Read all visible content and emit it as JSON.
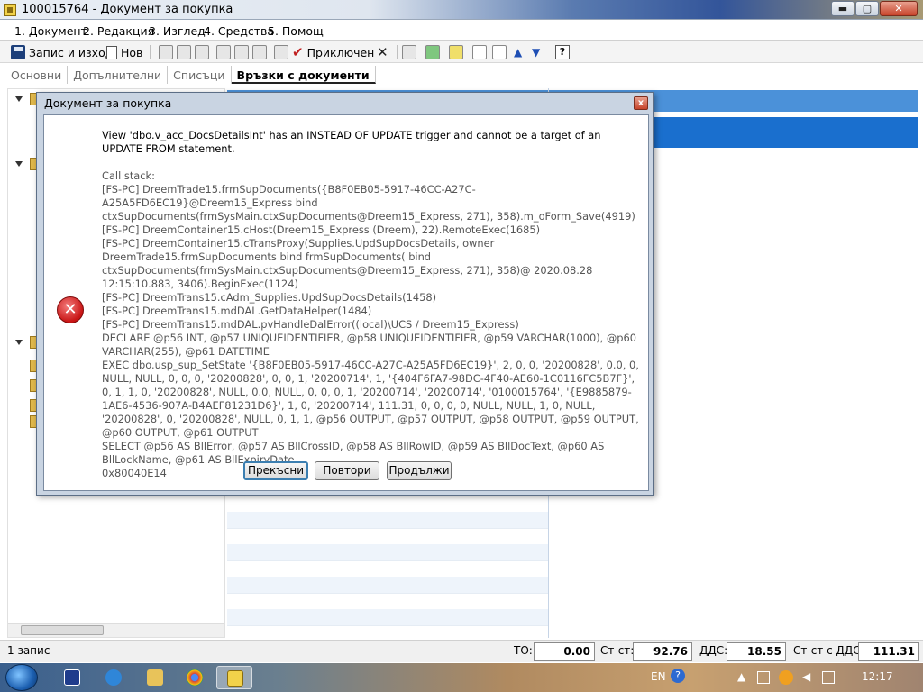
{
  "window": {
    "title": "100015764 - Документ за покупка",
    "buttons": {
      "minimize": "▬",
      "maximize": "▢",
      "close": "✕"
    }
  },
  "menu": [
    {
      "label": "1. Документ"
    },
    {
      "label": "2. Редакция"
    },
    {
      "label": "3. Изглед"
    },
    {
      "label": "4. Средства"
    },
    {
      "label": "5. Помощ"
    }
  ],
  "toolbar": {
    "save_exit_label": "Запис и изход",
    "new_label": "Нов",
    "attached_label": "Приключен",
    "help_label": "?"
  },
  "tabs": [
    {
      "label": "Основни"
    },
    {
      "label": "Допълнителни"
    },
    {
      "label": "Списъци"
    },
    {
      "label": "Връзки с документи",
      "active": true
    }
  ],
  "dialog": {
    "title": "Документ за покупка",
    "close_label": "x",
    "icon": "error-icon",
    "message": "View 'dbo.v_acc_DocsDetailsInt' has an INSTEAD OF UPDATE trigger and cannot be a target of an UPDATE FROM statement.",
    "stack_lines": [
      "Call stack:",
      "[FS-PC] DreemTrade15.frmSupDocuments({B8F0EB05-5917-46CC-A27C-A25A5FD6EC19}@Dreem15_Express bind ctxSupDocuments(frmSysMain.ctxSupDocuments@Dreem15_Express, 271), 358).m_oForm_Save(4919)",
      "[FS-PC] DreemContainer15.cHost(Dreem15_Express (Dreem), 22).RemoteExec(1685)",
      "[FS-PC] DreemContainer15.cTransProxy(Supplies.UpdSupDocsDetails, owner DreemTrade15.frmSupDocuments bind frmSupDocuments( bind ctxSupDocuments(frmSysMain.ctxSupDocuments@Dreem15_Express, 271), 358)@ 2020.08.28 12:15:10.883, 3406).BeginExec(1124)",
      "[FS-PC] DreemTrans15.cAdm_Supplies.UpdSupDocsDetails(1458)",
      "[FS-PC] DreemTrans15.mdDAL.GetDataHelper(1484)",
      "[FS-PC] DreemTrans15.mdDAL.pvHandleDalError((local)\\UCS / Dreem15_Express)",
      "DECLARE @p56 INT, @p57 UNIQUEIDENTIFIER, @p58 UNIQUEIDENTIFIER, @p59 VARCHAR(1000), @p60 VARCHAR(255), @p61 DATETIME",
      "EXEC dbo.usp_sup_SetState '{B8F0EB05-5917-46CC-A27C-A25A5FD6EC19}', 2, 0, 0, '20200828', 0.0, 0, NULL, NULL, 0, 0, 0, '20200828', 0, 0, 1, '20200714', 1, '{404F6FA7-98DC-4F40-AE60-1C0116FC5B7F}', 0, 1, 1, 0, '20200828', NULL, 0.0, NULL, 0, 0, 0, 1, '20200714', '20200714', '0100015764', '{E9885879-1AE6-4536-907A-B4AEF81231D6}', 1, 0, '20200714', 111.31, 0, 0, 0, 0, NULL, NULL, 1, 0, NULL, '20200828', 0, '20200828', NULL, 0, 1, 1, @p56 OUTPUT, @p57 OUTPUT, @p58 OUTPUT, @p59 OUTPUT, @p60 OUTPUT, @p61 OUTPUT",
      "SELECT @p56 AS BllError, @p57 AS BllCrossID, @p58 AS BllRowID, @p59 AS BllDocText, @p60 AS BllLockName, @p61 AS BllExpiryDate",
      "0x80040E14"
    ],
    "buttons": {
      "abort": "Прекъсни",
      "retry": "Повтори",
      "continue": "Продължи"
    }
  },
  "status": {
    "record_count": "1 запис",
    "to_label": "ТО:",
    "to_value": "0.00",
    "cost_label": "Ст-ст:",
    "cost_value": "92.76",
    "vat_label": "ДДС:",
    "vat_value": "18.55",
    "cost_vat_label": "Ст-ст с ДДС:",
    "cost_vat_value": "111.31"
  },
  "taskbar": {
    "language": "EN",
    "clock": "12:17"
  }
}
